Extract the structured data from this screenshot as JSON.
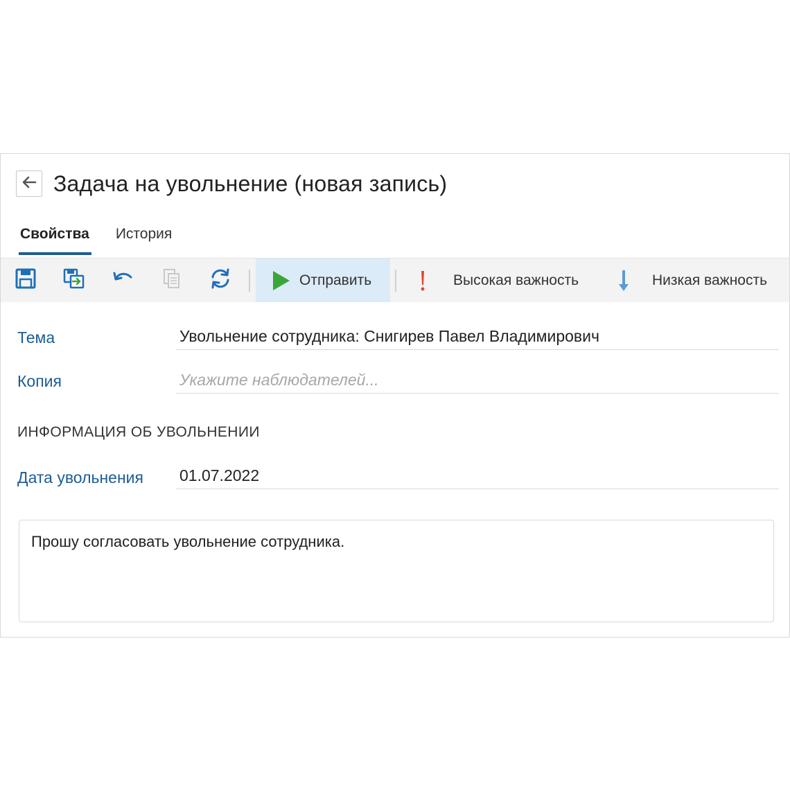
{
  "window": {
    "title": "Задача на увольнение (новая запись)"
  },
  "tabs": [
    {
      "label": "Свойства",
      "active": true
    },
    {
      "label": "История",
      "active": false
    }
  ],
  "toolbar": {
    "icons": [
      "save-icon",
      "save-and-close-icon",
      "undo-icon",
      "copy-icon",
      "refresh-icon"
    ],
    "send_label": "Отправить",
    "high_importance_label": "Высокая важность",
    "low_importance_label": "Низкая важность",
    "colors": {
      "send_highlight": "#dcebf8",
      "send_icon": "#3aa63a",
      "high_importance_icon": "#e1462c",
      "low_importance_icon": "#5b9bd5",
      "accent": "#1e5c93"
    }
  },
  "form": {
    "subject": {
      "label": "Тема",
      "value": "Увольнение сотрудника: Снигирев Павел Владимирович"
    },
    "copy": {
      "label": "Копия",
      "placeholder": "Укажите наблюдателей..."
    },
    "section_title": "ИНФОРМАЦИЯ ОБ УВОЛЬНЕНИИ",
    "dismissal_date": {
      "label": "Дата увольнения",
      "value": "01.07.2022"
    },
    "comment": "Прошу согласовать увольнение сотрудника."
  }
}
